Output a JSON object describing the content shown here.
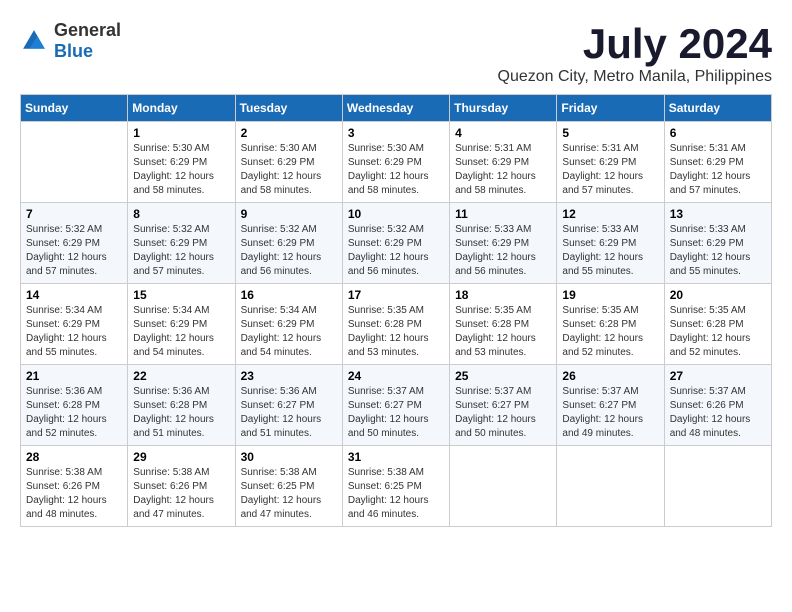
{
  "header": {
    "logo_general": "General",
    "logo_blue": "Blue",
    "title": "July 2024",
    "subtitle": "Quezon City, Metro Manila, Philippines"
  },
  "weekdays": [
    "Sunday",
    "Monday",
    "Tuesday",
    "Wednesday",
    "Thursday",
    "Friday",
    "Saturday"
  ],
  "weeks": [
    [
      {
        "day": "",
        "sunrise": "",
        "sunset": "",
        "daylight": ""
      },
      {
        "day": "1",
        "sunrise": "Sunrise: 5:30 AM",
        "sunset": "Sunset: 6:29 PM",
        "daylight": "Daylight: 12 hours and 58 minutes."
      },
      {
        "day": "2",
        "sunrise": "Sunrise: 5:30 AM",
        "sunset": "Sunset: 6:29 PM",
        "daylight": "Daylight: 12 hours and 58 minutes."
      },
      {
        "day": "3",
        "sunrise": "Sunrise: 5:30 AM",
        "sunset": "Sunset: 6:29 PM",
        "daylight": "Daylight: 12 hours and 58 minutes."
      },
      {
        "day": "4",
        "sunrise": "Sunrise: 5:31 AM",
        "sunset": "Sunset: 6:29 PM",
        "daylight": "Daylight: 12 hours and 58 minutes."
      },
      {
        "day": "5",
        "sunrise": "Sunrise: 5:31 AM",
        "sunset": "Sunset: 6:29 PM",
        "daylight": "Daylight: 12 hours and 57 minutes."
      },
      {
        "day": "6",
        "sunrise": "Sunrise: 5:31 AM",
        "sunset": "Sunset: 6:29 PM",
        "daylight": "Daylight: 12 hours and 57 minutes."
      }
    ],
    [
      {
        "day": "7",
        "sunrise": "Sunrise: 5:32 AM",
        "sunset": "Sunset: 6:29 PM",
        "daylight": "Daylight: 12 hours and 57 minutes."
      },
      {
        "day": "8",
        "sunrise": "Sunrise: 5:32 AM",
        "sunset": "Sunset: 6:29 PM",
        "daylight": "Daylight: 12 hours and 57 minutes."
      },
      {
        "day": "9",
        "sunrise": "Sunrise: 5:32 AM",
        "sunset": "Sunset: 6:29 PM",
        "daylight": "Daylight: 12 hours and 56 minutes."
      },
      {
        "day": "10",
        "sunrise": "Sunrise: 5:32 AM",
        "sunset": "Sunset: 6:29 PM",
        "daylight": "Daylight: 12 hours and 56 minutes."
      },
      {
        "day": "11",
        "sunrise": "Sunrise: 5:33 AM",
        "sunset": "Sunset: 6:29 PM",
        "daylight": "Daylight: 12 hours and 56 minutes."
      },
      {
        "day": "12",
        "sunrise": "Sunrise: 5:33 AM",
        "sunset": "Sunset: 6:29 PM",
        "daylight": "Daylight: 12 hours and 55 minutes."
      },
      {
        "day": "13",
        "sunrise": "Sunrise: 5:33 AM",
        "sunset": "Sunset: 6:29 PM",
        "daylight": "Daylight: 12 hours and 55 minutes."
      }
    ],
    [
      {
        "day": "14",
        "sunrise": "Sunrise: 5:34 AM",
        "sunset": "Sunset: 6:29 PM",
        "daylight": "Daylight: 12 hours and 55 minutes."
      },
      {
        "day": "15",
        "sunrise": "Sunrise: 5:34 AM",
        "sunset": "Sunset: 6:29 PM",
        "daylight": "Daylight: 12 hours and 54 minutes."
      },
      {
        "day": "16",
        "sunrise": "Sunrise: 5:34 AM",
        "sunset": "Sunset: 6:29 PM",
        "daylight": "Daylight: 12 hours and 54 minutes."
      },
      {
        "day": "17",
        "sunrise": "Sunrise: 5:35 AM",
        "sunset": "Sunset: 6:28 PM",
        "daylight": "Daylight: 12 hours and 53 minutes."
      },
      {
        "day": "18",
        "sunrise": "Sunrise: 5:35 AM",
        "sunset": "Sunset: 6:28 PM",
        "daylight": "Daylight: 12 hours and 53 minutes."
      },
      {
        "day": "19",
        "sunrise": "Sunrise: 5:35 AM",
        "sunset": "Sunset: 6:28 PM",
        "daylight": "Daylight: 12 hours and 52 minutes."
      },
      {
        "day": "20",
        "sunrise": "Sunrise: 5:35 AM",
        "sunset": "Sunset: 6:28 PM",
        "daylight": "Daylight: 12 hours and 52 minutes."
      }
    ],
    [
      {
        "day": "21",
        "sunrise": "Sunrise: 5:36 AM",
        "sunset": "Sunset: 6:28 PM",
        "daylight": "Daylight: 12 hours and 52 minutes."
      },
      {
        "day": "22",
        "sunrise": "Sunrise: 5:36 AM",
        "sunset": "Sunset: 6:28 PM",
        "daylight": "Daylight: 12 hours and 51 minutes."
      },
      {
        "day": "23",
        "sunrise": "Sunrise: 5:36 AM",
        "sunset": "Sunset: 6:27 PM",
        "daylight": "Daylight: 12 hours and 51 minutes."
      },
      {
        "day": "24",
        "sunrise": "Sunrise: 5:37 AM",
        "sunset": "Sunset: 6:27 PM",
        "daylight": "Daylight: 12 hours and 50 minutes."
      },
      {
        "day": "25",
        "sunrise": "Sunrise: 5:37 AM",
        "sunset": "Sunset: 6:27 PM",
        "daylight": "Daylight: 12 hours and 50 minutes."
      },
      {
        "day": "26",
        "sunrise": "Sunrise: 5:37 AM",
        "sunset": "Sunset: 6:27 PM",
        "daylight": "Daylight: 12 hours and 49 minutes."
      },
      {
        "day": "27",
        "sunrise": "Sunrise: 5:37 AM",
        "sunset": "Sunset: 6:26 PM",
        "daylight": "Daylight: 12 hours and 48 minutes."
      }
    ],
    [
      {
        "day": "28",
        "sunrise": "Sunrise: 5:38 AM",
        "sunset": "Sunset: 6:26 PM",
        "daylight": "Daylight: 12 hours and 48 minutes."
      },
      {
        "day": "29",
        "sunrise": "Sunrise: 5:38 AM",
        "sunset": "Sunset: 6:26 PM",
        "daylight": "Daylight: 12 hours and 47 minutes."
      },
      {
        "day": "30",
        "sunrise": "Sunrise: 5:38 AM",
        "sunset": "Sunset: 6:25 PM",
        "daylight": "Daylight: 12 hours and 47 minutes."
      },
      {
        "day": "31",
        "sunrise": "Sunrise: 5:38 AM",
        "sunset": "Sunset: 6:25 PM",
        "daylight": "Daylight: 12 hours and 46 minutes."
      },
      {
        "day": "",
        "sunrise": "",
        "sunset": "",
        "daylight": ""
      },
      {
        "day": "",
        "sunrise": "",
        "sunset": "",
        "daylight": ""
      },
      {
        "day": "",
        "sunrise": "",
        "sunset": "",
        "daylight": ""
      }
    ]
  ]
}
